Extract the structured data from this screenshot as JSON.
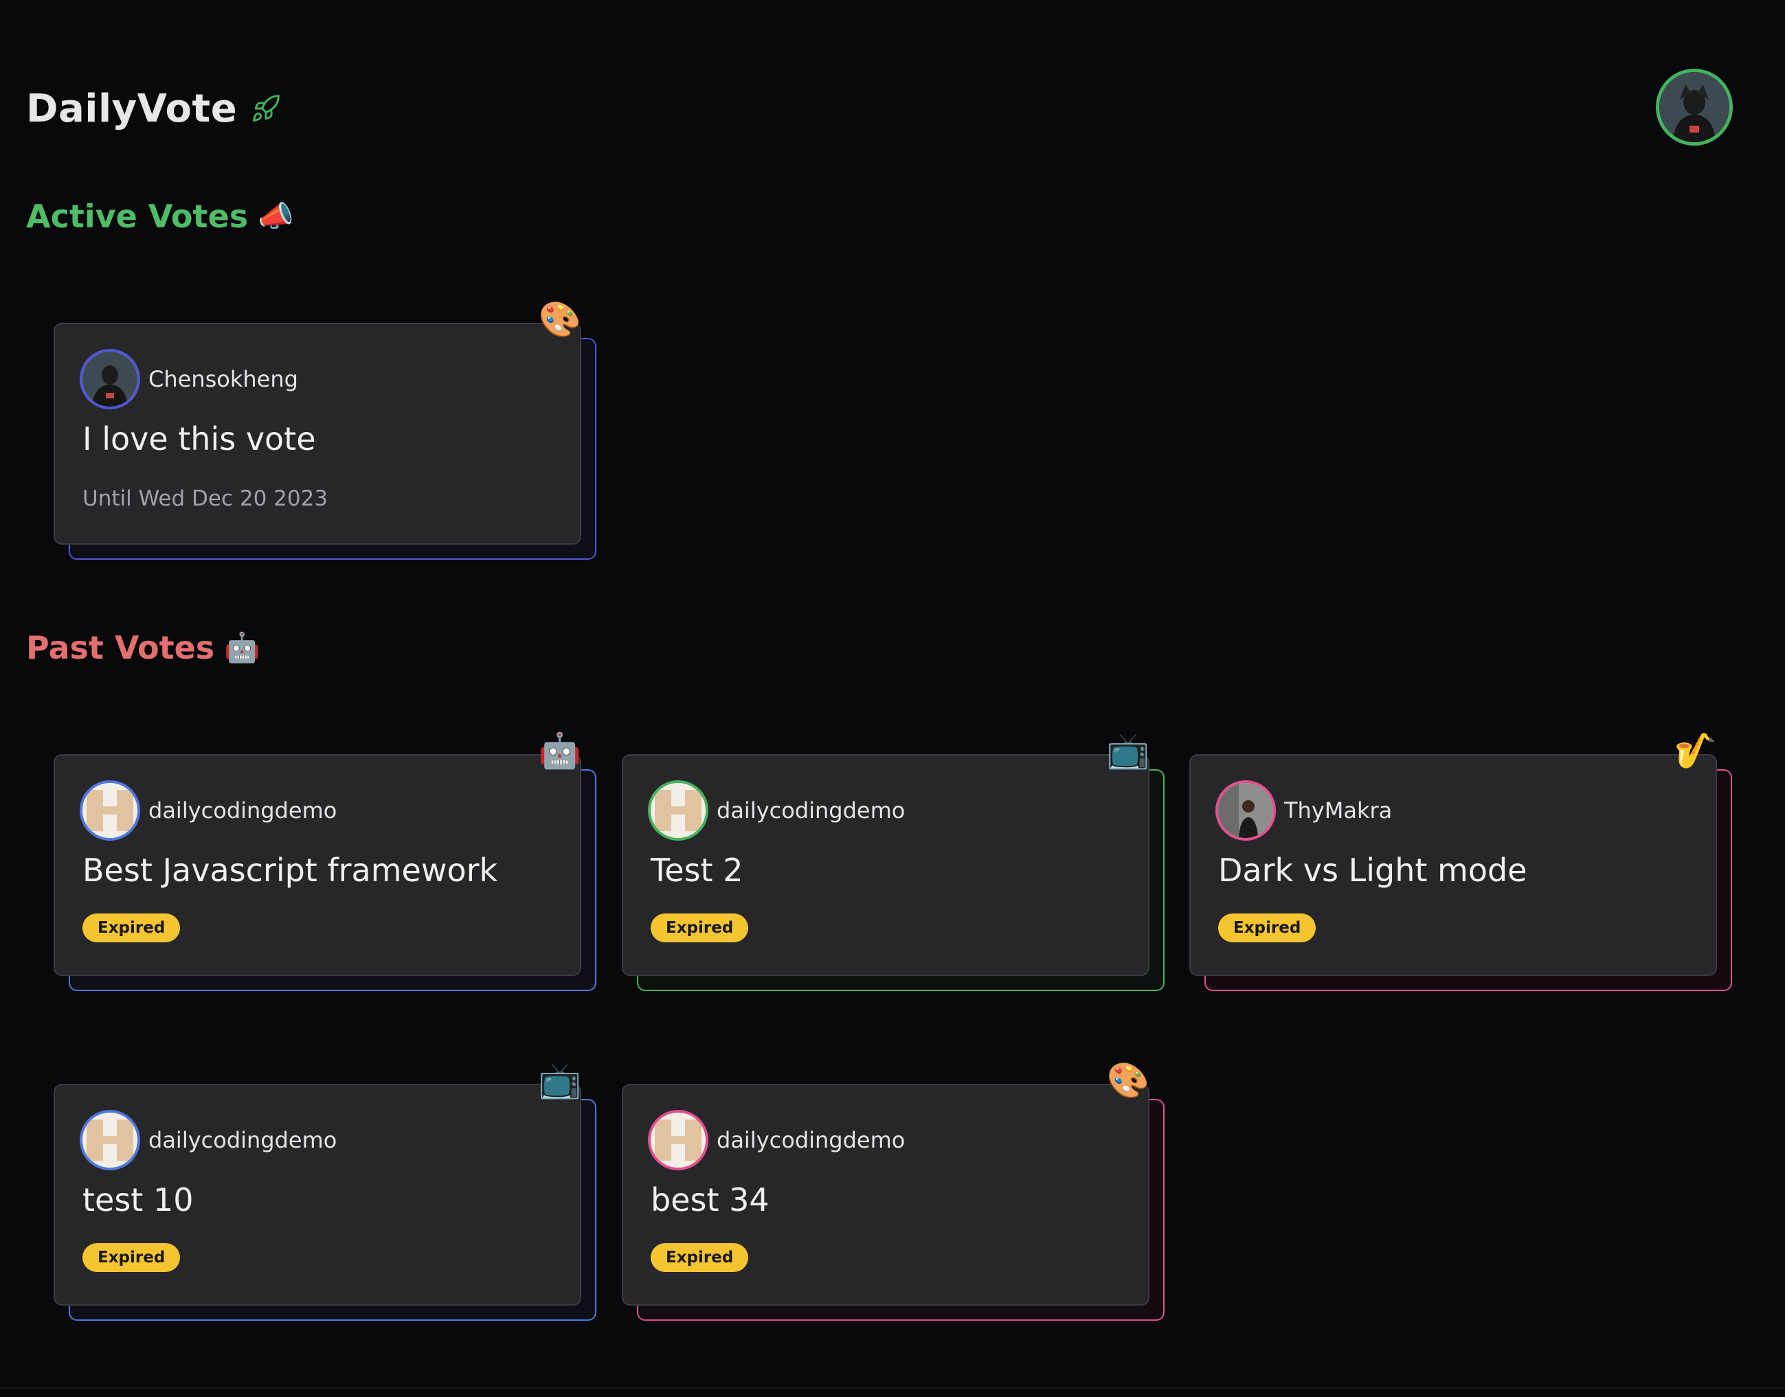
{
  "app": {
    "title": "DailyVote"
  },
  "sections": {
    "active": {
      "heading": "Active Votes",
      "emoji": "📣"
    },
    "past": {
      "heading": "Past Votes",
      "emoji": "🤖"
    }
  },
  "active_votes": [
    {
      "author": "Chensokheng",
      "title": "I love this vote",
      "until": "Until Wed Dec 20 2023",
      "emoji": "🎨",
      "accent": "#5057d6"
    }
  ],
  "past_votes": [
    {
      "author": "dailycodingdemo",
      "title": "Best Javascript framework",
      "status": "Expired",
      "emoji": "🤖",
      "accent": "#4f79e0"
    },
    {
      "author": "dailycodingdemo",
      "title": "Test 2",
      "status": "Expired",
      "emoji": "📺",
      "accent": "#45b35d"
    },
    {
      "author": "ThyMakra",
      "title": "Dark vs Light mode",
      "status": "Expired",
      "emoji": "🎷",
      "accent": "#e0508f"
    },
    {
      "author": "dailycodingdemo",
      "title": "test 10",
      "status": "Expired",
      "emoji": "📺",
      "accent": "#4f79e0"
    },
    {
      "author": "dailycodingdemo",
      "title": "best 34",
      "status": "Expired",
      "emoji": "🎨",
      "accent": "#e0508f"
    }
  ],
  "colors": {
    "background": "#09090b",
    "card": "#27272a",
    "active_heading": "#4fbc68",
    "past_heading": "#e46f6f",
    "badge": "#f5c531"
  }
}
